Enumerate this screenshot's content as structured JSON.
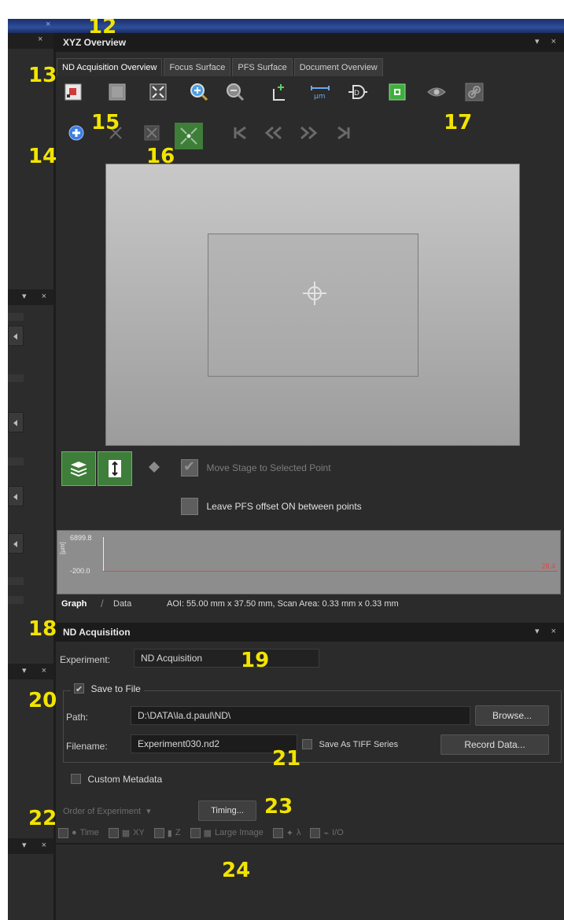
{
  "window": {
    "close_glyph": "×"
  },
  "overview_panel": {
    "title": "XYZ Overview",
    "controls": "▾ ×",
    "tabs": [
      {
        "label": "ND Acquisition Overview",
        "active": true
      },
      {
        "label": "Focus Surface"
      },
      {
        "label": "PFS Surface"
      },
      {
        "label": "Document Overview"
      }
    ],
    "toolbar_icons": [
      "stage-position-icon",
      "image-icon",
      "fit-view-icon",
      "zoom-in-icon",
      "zoom-out-icon",
      "add-point-icon",
      "scale-bar-icon",
      "focus-drive-icon",
      "capture-icon",
      "eye-icon",
      "link-icon"
    ],
    "nav_icons": [
      "add-icon",
      "delete-icon",
      "clear-icon",
      "center-icon",
      "first-icon",
      "previous-icon",
      "next-icon",
      "last-icon"
    ],
    "move_stage_label": "Move Stage to Selected Point",
    "leave_pfs_label": "Leave PFS offset ON between points",
    "graph": {
      "ymax": "6899.8",
      "ymin": "-200.0",
      "yunit": "[µm]",
      "current": "28.4"
    },
    "graph_tabs": [
      "Graph",
      "Data"
    ],
    "status": "AOI: 55.00 mm x 37.50 mm, Scan Area: 0.33 mm x 0.33 mm"
  },
  "nd_panel": {
    "title": "ND Acquisition",
    "controls": "▾ ×",
    "experiment_label": "Experiment:",
    "experiment_value": "ND Acquisition",
    "save_to_file": "Save to File",
    "path_label": "Path:",
    "path_value": "D:\\DATA\\la.d.paul\\ND\\",
    "browse": "Browse...",
    "filename_label": "Filename:",
    "filename_value": "Experiment030.nd2",
    "save_tiff": "Save As TIFF Series",
    "record_data": "Record Data...",
    "custom_metadata": "Custom Metadata",
    "order": "Order of Experiment",
    "timing": "Timing...",
    "dims": [
      "Time",
      "XY",
      "Z",
      "Large Image",
      "λ",
      "I/O"
    ]
  },
  "dock": {
    "controls": "▾ ×"
  },
  "callouts": {
    "n12": "12",
    "n13": "13",
    "n14": "14",
    "n15": "15",
    "n16": "16",
    "n17": "17",
    "n18": "18",
    "n19": "19",
    "n20": "20",
    "n21": "21",
    "n22": "22",
    "n23": "23",
    "n24": "24"
  },
  "colors": {
    "accent_green": "#3f7d3a",
    "callout_yellow": "#f2e400",
    "graph_line": "#d64b4b"
  }
}
